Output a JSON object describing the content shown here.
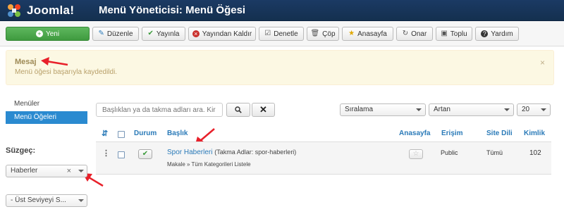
{
  "header": {
    "logo_text": "Joomla!",
    "title": "Menü Yöneticisi: Menü Öğesi"
  },
  "toolbar": {
    "new": "Yeni",
    "edit": "Düzenle",
    "publish": "Yayınla",
    "unpublish": "Yayından Kaldır",
    "check_in": "Denetle",
    "trash": "Çöp",
    "home": "Anasayfa",
    "rebuild": "Onar",
    "batch": "Toplu",
    "help": "Yardım"
  },
  "message": {
    "title": "Mesaj",
    "text": "Menü öğesi başarıyla kaydedildi.",
    "close": "×"
  },
  "sidebar": {
    "items": [
      {
        "label": "Menüler"
      },
      {
        "label": "Menü Öğeleri"
      }
    ],
    "filter_title": "Süzgeç:",
    "filter_menu": "Haberler",
    "filter_level": "- Üst Seviyeyi S..."
  },
  "search": {
    "placeholder": "Başlıklan ya da takma adları ara. Kir"
  },
  "sorting": {
    "ordering": "Sıralama",
    "direction": "Artan",
    "limit": "20"
  },
  "table": {
    "headers": {
      "status": "Durum",
      "title": "Başlık",
      "home": "Anasayfa",
      "access": "Erişim",
      "language": "Site Dili",
      "id": "Kimlik"
    },
    "rows": [
      {
        "title": "Spor Haberleri",
        "alias": "(Takma Adlar: spor-haberleri)",
        "path": "Makale » Tüm Kategorileri Listele",
        "access": "Public",
        "language": "Tümü",
        "id": "102"
      }
    ]
  },
  "colors": {
    "header": "#1b3a64",
    "accent": "#2a8ad0",
    "success": "#3f9a3f",
    "alert_bg": "#fcf8e3",
    "arrow": "#e8202a"
  }
}
